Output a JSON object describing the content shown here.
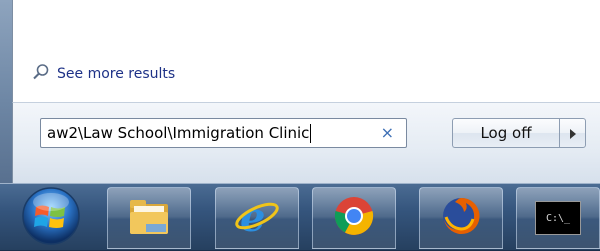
{
  "start_menu": {
    "see_more_label": "See more results",
    "search": {
      "value": "aw2\\Law School\\Immigration Clinic",
      "clear_symbol": "×"
    },
    "logoff_label": "Log off",
    "logoff_arrow_symbol": "►"
  },
  "taskbar": {
    "items": [
      {
        "name": "windows-explorer",
        "icon": "folder-icon"
      },
      {
        "name": "internet-explorer",
        "icon": "internet-explorer-icon"
      },
      {
        "name": "google-chrome",
        "icon": "chrome-icon"
      },
      {
        "name": "firefox",
        "icon": "firefox-icon"
      },
      {
        "name": "command-prompt",
        "icon": "command-prompt-icon"
      }
    ],
    "cmd_icon_text": "C:\\_"
  },
  "colors": {
    "link": "#1e3287",
    "search_clear": "#3d6fb5",
    "taskbar": "#35557d"
  }
}
